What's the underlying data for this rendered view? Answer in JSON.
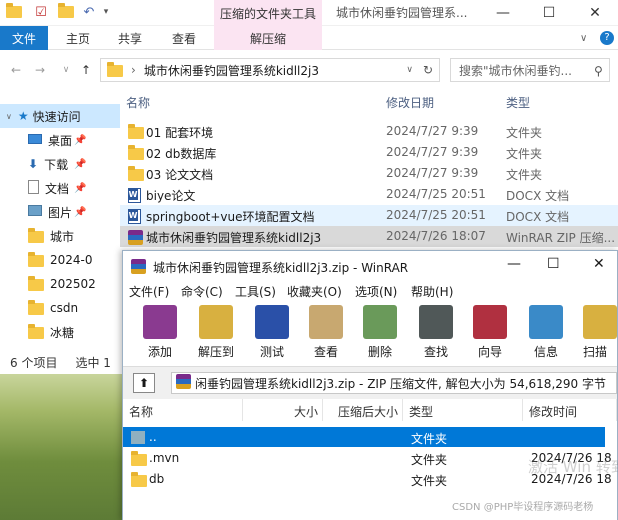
{
  "explorer": {
    "context_tab": "压缩的文件夹工具",
    "window_title": "城市休闲垂钓园管理系...",
    "ribbon_tabs": {
      "file": "文件",
      "home": "主页",
      "share": "共享",
      "view": "查看",
      "extract": "解压缩"
    },
    "address": "城市休闲垂钓园管理系统kidll2j3",
    "search_placeholder": "搜索\"城市休闲垂钓...",
    "nav": [
      {
        "label": "快速访问",
        "icon": "star-icon"
      },
      {
        "label": "桌面",
        "icon": "desktop-icon"
      },
      {
        "label": "下载",
        "icon": "download-icon"
      },
      {
        "label": "文档",
        "icon": "document-icon"
      },
      {
        "label": "图片",
        "icon": "picture-icon"
      },
      {
        "label": "城市",
        "icon": "folder-icon"
      },
      {
        "label": "2024-0",
        "icon": "folder-icon"
      },
      {
        "label": "202502",
        "icon": "folder-icon"
      },
      {
        "label": "csdn",
        "icon": "folder-icon"
      },
      {
        "label": "冰糖",
        "icon": "folder-icon"
      }
    ],
    "columns": {
      "name": "名称",
      "date": "修改日期",
      "type": "类型"
    },
    "files": [
      {
        "name": "01 配套环境",
        "date": "2024/7/27 9:39",
        "type": "文件夹",
        "icon": "folder-icon"
      },
      {
        "name": "02 db数据库",
        "date": "2024/7/27 9:39",
        "type": "文件夹",
        "icon": "folder-icon"
      },
      {
        "name": "03 论文文档",
        "date": "2024/7/27 9:39",
        "type": "文件夹",
        "icon": "folder-icon"
      },
      {
        "name": "biye论文",
        "date": "2024/7/25 20:51",
        "type": "DOCX 文档",
        "icon": "docx-icon"
      },
      {
        "name": "springboot+vue环境配置文档",
        "date": "2024/7/25 20:51",
        "type": "DOCX 文档",
        "icon": "docx-icon"
      },
      {
        "name": "城市休闲垂钓园管理系统kidll2j3",
        "date": "2024/7/26 18:07",
        "type": "WinRAR ZIP 压缩...",
        "icon": "rar-icon"
      }
    ],
    "status": {
      "count": "6 个项目",
      "selected": "选中 1"
    }
  },
  "winrar": {
    "title": "城市休闲垂钓园管理系统kidll2j3.zip - WinRAR",
    "menu": [
      "文件(F)",
      "命令(C)",
      "工具(S)",
      "收藏夹(O)",
      "选项(N)",
      "帮助(H)"
    ],
    "toolbar": [
      {
        "label": "添加",
        "icon": "add-archive-icon",
        "color": "#8a3a90"
      },
      {
        "label": "解压到",
        "icon": "extract-to-icon",
        "color": "#d8b040"
      },
      {
        "label": "测试",
        "icon": "test-icon",
        "color": "#2a50a8"
      },
      {
        "label": "查看",
        "icon": "view-icon",
        "color": "#c8a870"
      },
      {
        "label": "删除",
        "icon": "delete-icon",
        "color": "#6a9a5a"
      },
      {
        "label": "查找",
        "icon": "find-icon",
        "color": "#505858"
      },
      {
        "label": "向导",
        "icon": "wizard-icon",
        "color": "#b03040"
      },
      {
        "label": "信息",
        "icon": "info-icon",
        "color": "#3a8ac8"
      },
      {
        "label": "扫描",
        "icon": "scan-icon",
        "color": "#d8b040"
      }
    ],
    "path": "闲垂钓园管理系统kidll2j3.zip - ZIP 压缩文件, 解包大小为 54,618,290 字节",
    "columns": {
      "name": "名称",
      "size": "大小",
      "packed": "压缩后大小",
      "type": "类型",
      "modified": "修改时间"
    },
    "rows": [
      {
        "name": "..",
        "type": "文件夹",
        "modified": "",
        "icon": "parent-folder-icon",
        "selected": true
      },
      {
        "name": ".mvn",
        "type": "文件夹",
        "modified": "2024/7/26 18",
        "icon": "folder-icon"
      },
      {
        "name": "db",
        "type": "文件夹",
        "modified": "2024/7/26 18",
        "icon": "folder-icon"
      }
    ]
  },
  "overlay": {
    "watermark": "CSDN @PHP毕设程序源码老杨",
    "activate": "激活 Win 转到\"设置\""
  }
}
